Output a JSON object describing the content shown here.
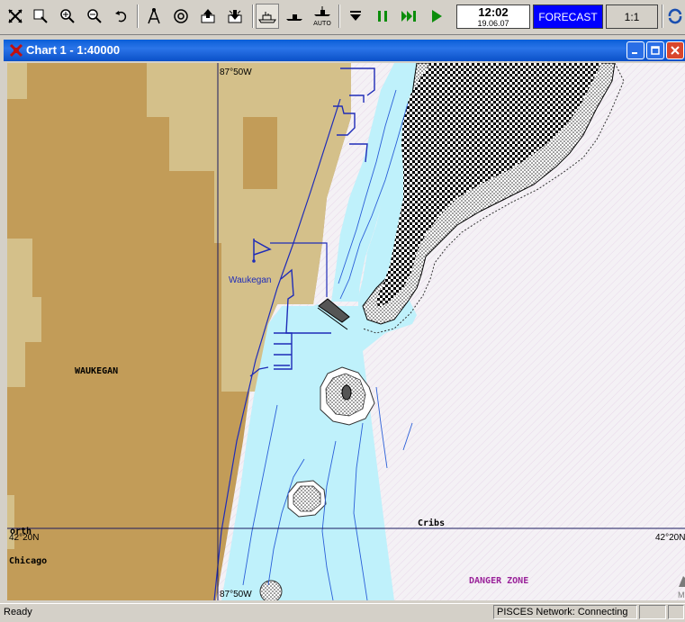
{
  "toolbar": {
    "clock_time": "12:02",
    "clock_date": "19.06.07",
    "forecast_label": "FORECAST",
    "scale_label": "1:1",
    "auto_label": "AUTO",
    "icons": [
      "fit-icon",
      "zoom-window-icon",
      "zoom-in-icon",
      "zoom-out-icon",
      "undo-zoom-icon",
      "route-icon",
      "target-icon",
      "export-icon",
      "import-icon",
      "ship-head-up-icon",
      "ship-north-up-icon",
      "ship-auto-icon",
      "drop-down-icon",
      "pause-icon",
      "fast-forward-icon",
      "play-icon",
      "rotate-icon"
    ]
  },
  "window": {
    "title": "Chart 1 - 1:40000"
  },
  "map": {
    "labels": {
      "top_longitude": "87°50W",
      "bottom_longitude": "87°50W",
      "left_latitude": "42°20N",
      "right_latitude": "42°20N",
      "town": "WAUKEGAN",
      "harbor": "Waukegan",
      "cribs": "Cribs",
      "chicago": "Chicago",
      "danger_zone": "DANGER ZONE",
      "north_partial": "orth",
      "corner_partial": "M"
    },
    "colors": {
      "land_dark": "#c29c58",
      "land_light": "#d4c08a",
      "shallow_water": "#bff1fb",
      "deep_water": "#f3f0f4",
      "chart_lines": "#1f2cb8",
      "danger_text": "#9a229a"
    }
  },
  "status": {
    "ready": "Ready",
    "network": "PISCES Network: Connecting"
  }
}
